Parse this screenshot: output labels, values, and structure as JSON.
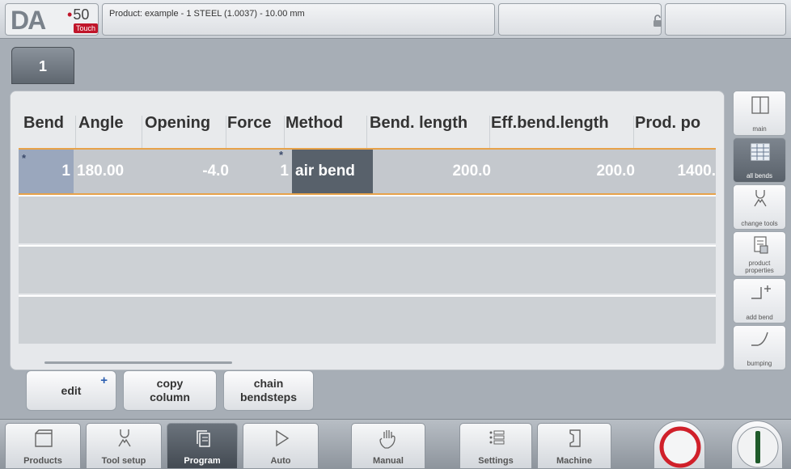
{
  "header": {
    "logo_text": "DA",
    "logo_model": "50",
    "logo_sub": "Touch",
    "product_title": "Product: example - 1 STEEL (1.0037) - 10.00 mm"
  },
  "tabs": [
    {
      "label": "1"
    }
  ],
  "table": {
    "columns": [
      "Bend",
      "Angle",
      "Opening",
      "Force",
      "Method",
      "Bend. length",
      "Eff.bend.length",
      "Prod. po"
    ],
    "rows": [
      {
        "bend": "1",
        "angle": "180.00",
        "opening": "-4.0",
        "force": "1",
        "method": "air bend",
        "bend_length": "200.0",
        "eff_bend_length": "200.0",
        "prod_po": "1400."
      }
    ],
    "star_marker": "*"
  },
  "side_buttons": [
    {
      "label": "main",
      "icon": "split-view-icon"
    },
    {
      "label": "all bends",
      "icon": "table-icon"
    },
    {
      "label": "change tools",
      "icon": "tools-icon"
    },
    {
      "label": "product properties",
      "icon": "properties-icon"
    },
    {
      "label": "add bend",
      "icon": "add-bend-icon"
    },
    {
      "label": "bumping",
      "icon": "bumping-icon"
    }
  ],
  "actions": {
    "edit_label": "edit",
    "edit_plus": "+",
    "copy_label": "copy column",
    "chain_label": "chain bendsteps"
  },
  "nav": [
    {
      "label": "Products",
      "icon": "folder-icon"
    },
    {
      "label": "Tool setup",
      "icon": "tool-setup-icon"
    },
    {
      "label": "Program",
      "icon": "program-icon"
    },
    {
      "label": "Auto",
      "icon": "play-icon"
    },
    {
      "label": "Manual",
      "icon": "hand-icon"
    },
    {
      "label": "Settings",
      "icon": "list-icon"
    },
    {
      "label": "Machine",
      "icon": "machine-icon"
    }
  ],
  "colors": {
    "accent": "#e7a24a",
    "active": "#59616a",
    "stop": "#d0202a",
    "start": "#1f5a2a"
  }
}
